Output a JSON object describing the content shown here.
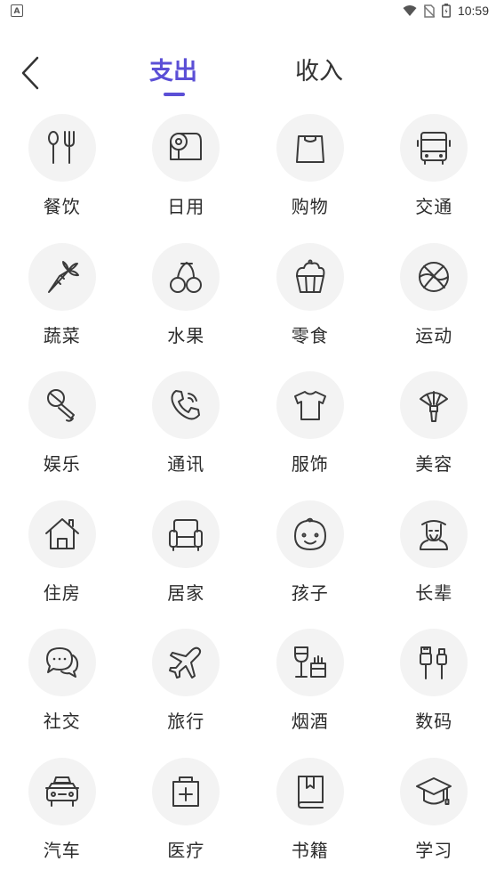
{
  "status_bar": {
    "time": "10:59"
  },
  "tabs": {
    "expense": "支出",
    "income": "收入"
  },
  "categories": [
    {
      "label": "餐饮",
      "icon": "utensils-icon"
    },
    {
      "label": "日用",
      "icon": "tissue-roll-icon"
    },
    {
      "label": "购物",
      "icon": "shopping-bag-icon"
    },
    {
      "label": "交通",
      "icon": "bus-icon"
    },
    {
      "label": "蔬菜",
      "icon": "carrot-icon"
    },
    {
      "label": "水果",
      "icon": "cherry-icon"
    },
    {
      "label": "零食",
      "icon": "cupcake-icon"
    },
    {
      "label": "运动",
      "icon": "basketball-icon"
    },
    {
      "label": "娱乐",
      "icon": "microphone-icon"
    },
    {
      "label": "通讯",
      "icon": "phone-icon"
    },
    {
      "label": "服饰",
      "icon": "tshirt-icon"
    },
    {
      "label": "美容",
      "icon": "beauty-brush-icon"
    },
    {
      "label": "住房",
      "icon": "house-icon"
    },
    {
      "label": "居家",
      "icon": "sofa-icon"
    },
    {
      "label": "孩子",
      "icon": "baby-face-icon"
    },
    {
      "label": "长辈",
      "icon": "elder-icon"
    },
    {
      "label": "社交",
      "icon": "chat-bubbles-icon"
    },
    {
      "label": "旅行",
      "icon": "airplane-icon"
    },
    {
      "label": "烟酒",
      "icon": "wine-cigarette-icon"
    },
    {
      "label": "数码",
      "icon": "usb-cable-icon"
    },
    {
      "label": "汽车",
      "icon": "car-icon"
    },
    {
      "label": "医疗",
      "icon": "medical-bag-icon"
    },
    {
      "label": "书籍",
      "icon": "book-icon"
    },
    {
      "label": "学习",
      "icon": "graduation-cap-icon"
    }
  ]
}
